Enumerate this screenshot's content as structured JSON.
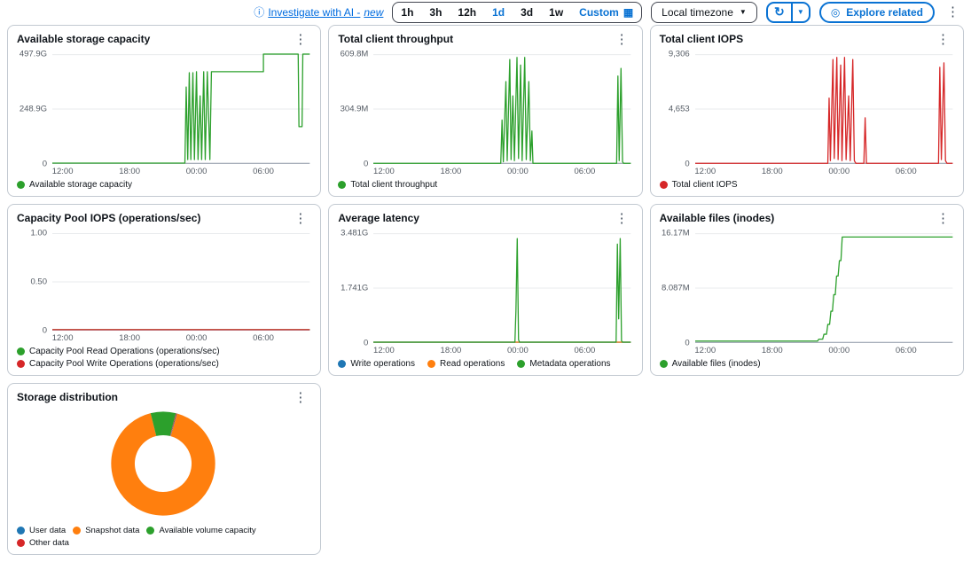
{
  "icons": {
    "info": "ⓘ",
    "calendar": "▦",
    "caret_down": "▼",
    "refresh": "↻",
    "explore": "◎",
    "kebab": "⋮"
  },
  "palette": {
    "blue": "#1f77b4",
    "orange": "#ff7f0e",
    "green": "#2ca02c",
    "red": "#d62728",
    "link": "#006ce0",
    "button_blue": "#0972d3"
  },
  "toolbar": {
    "investigate_label": "Investigate with AI -",
    "investigate_new": "new",
    "time_ranges": [
      "1h",
      "3h",
      "12h",
      "1d",
      "3d",
      "1w",
      "Custom"
    ],
    "selected_range": "1d",
    "timezone_label": "Local timezone",
    "explore_label": "Explore related"
  },
  "charts": [
    {
      "type": "line",
      "title": "Available storage capacity",
      "y_ticks": [
        "497.9G",
        "248.9G",
        "0"
      ],
      "x_ticks": [
        {
          "label": "12:00",
          "x": 4
        },
        {
          "label": "18:00",
          "x": 30
        },
        {
          "label": "00:00",
          "x": 56
        },
        {
          "label": "06:00",
          "x": 82
        }
      ],
      "legend": [
        {
          "label": "Available storage capacity",
          "color": "#2ca02c"
        }
      ],
      "series": [
        {
          "name": "Available storage capacity",
          "color": "#2ca02c",
          "points": [
            [
              0,
              0.8
            ],
            [
              51.5,
              0.8
            ],
            [
              52,
              70
            ],
            [
              52.6,
              4
            ],
            [
              53.2,
              83
            ],
            [
              53.8,
              4
            ],
            [
              54.6,
              83
            ],
            [
              55.2,
              4
            ],
            [
              56,
              84
            ],
            [
              56.6,
              4
            ],
            [
              57.4,
              62
            ],
            [
              58,
              4
            ],
            [
              58.8,
              84
            ],
            [
              59.4,
              4
            ],
            [
              60.2,
              84
            ],
            [
              61.2,
              4
            ],
            [
              61.8,
              84
            ],
            [
              82,
              84
            ],
            [
              82,
              100
            ],
            [
              95.5,
              100
            ],
            [
              95.8,
              34
            ],
            [
              97,
              34
            ],
            [
              97.3,
              100
            ],
            [
              100,
              100
            ]
          ]
        }
      ]
    },
    {
      "type": "line",
      "title": "Total client throughput",
      "y_ticks": [
        "609.8M",
        "304.9M",
        "0"
      ],
      "x_ticks": [
        {
          "label": "12:00",
          "x": 4
        },
        {
          "label": "18:00",
          "x": 30
        },
        {
          "label": "00:00",
          "x": 56
        },
        {
          "label": "06:00",
          "x": 82
        }
      ],
      "legend": [
        {
          "label": "Total client throughput",
          "color": "#2ca02c"
        }
      ],
      "series": [
        {
          "name": "Total client throughput",
          "color": "#2ca02c",
          "points": [
            [
              0,
              0.6
            ],
            [
              49.5,
              0.6
            ],
            [
              50,
              40
            ],
            [
              50.5,
              2
            ],
            [
              51.5,
              75
            ],
            [
              52,
              3
            ],
            [
              53,
              95
            ],
            [
              53.5,
              4
            ],
            [
              54.2,
              62
            ],
            [
              54.8,
              3
            ],
            [
              55.8,
              97
            ],
            [
              56.4,
              5
            ],
            [
              57.2,
              90
            ],
            [
              57.8,
              3
            ],
            [
              58.8,
              97
            ],
            [
              59.4,
              4
            ],
            [
              60.4,
              75
            ],
            [
              61,
              3
            ],
            [
              61.6,
              30
            ],
            [
              62,
              0.6
            ],
            [
              94.5,
              0.6
            ],
            [
              95,
              80
            ],
            [
              95.5,
              3
            ],
            [
              96.2,
              87
            ],
            [
              96.8,
              2
            ],
            [
              97.2,
              0.6
            ],
            [
              100,
              0.6
            ]
          ]
        }
      ]
    },
    {
      "type": "line",
      "title": "Total client IOPS",
      "y_ticks": [
        "9,306",
        "4,653",
        "0"
      ],
      "x_ticks": [
        {
          "label": "12:00",
          "x": 4
        },
        {
          "label": "18:00",
          "x": 30
        },
        {
          "label": "00:00",
          "x": 56
        },
        {
          "label": "06:00",
          "x": 82
        }
      ],
      "legend": [
        {
          "label": "Total client IOPS",
          "color": "#d62728"
        }
      ],
      "series": [
        {
          "name": "Total client IOPS",
          "color": "#d62728",
          "points": [
            [
              0,
              0.6
            ],
            [
              51.5,
              0.6
            ],
            [
              52,
              60
            ],
            [
              52.5,
              3
            ],
            [
              53.5,
              95
            ],
            [
              54,
              5
            ],
            [
              55,
              97
            ],
            [
              55.5,
              4
            ],
            [
              56.5,
              90
            ],
            [
              57,
              3
            ],
            [
              58,
              97
            ],
            [
              58.6,
              4
            ],
            [
              59.6,
              62
            ],
            [
              60.2,
              3
            ],
            [
              61.2,
              95
            ],
            [
              61.8,
              3
            ],
            [
              62.4,
              0.6
            ],
            [
              65.5,
              0.6
            ],
            [
              66,
              42
            ],
            [
              66.5,
              0.6
            ],
            [
              94.5,
              0.6
            ],
            [
              95,
              88
            ],
            [
              95.6,
              4
            ],
            [
              96.6,
              92
            ],
            [
              97.2,
              3
            ],
            [
              97.8,
              0.6
            ],
            [
              100,
              0.6
            ]
          ]
        }
      ]
    },
    {
      "type": "line",
      "title": "Capacity Pool IOPS (operations/sec)",
      "y_ticks": [
        "1.00",
        "0.50",
        "0"
      ],
      "x_ticks": [
        {
          "label": "12:00",
          "x": 4
        },
        {
          "label": "18:00",
          "x": 30
        },
        {
          "label": "00:00",
          "x": 56
        },
        {
          "label": "06:00",
          "x": 82
        }
      ],
      "legend": [
        {
          "label": "Capacity Pool Read Operations (operations/sec)",
          "color": "#2ca02c"
        },
        {
          "label": "Capacity Pool Write Operations (operations/sec)",
          "color": "#d62728"
        }
      ],
      "series": [
        {
          "name": "Capacity Pool Read Operations (operations/sec)",
          "color": "#2ca02c",
          "points": [
            [
              0,
              1
            ],
            [
              100,
              1
            ]
          ]
        },
        {
          "name": "Capacity Pool Write Operations (operations/sec)",
          "color": "#d62728",
          "points": [
            [
              0,
              1
            ],
            [
              100,
              1
            ]
          ]
        }
      ]
    },
    {
      "type": "line",
      "title": "Average latency",
      "y_ticks": [
        "3.481G",
        "1.741G",
        "0"
      ],
      "x_ticks": [
        {
          "label": "12:00",
          "x": 4
        },
        {
          "label": "18:00",
          "x": 30
        },
        {
          "label": "00:00",
          "x": 56
        },
        {
          "label": "06:00",
          "x": 82
        }
      ],
      "legend": [
        {
          "label": "Write operations",
          "color": "#1f77b4"
        },
        {
          "label": "Read operations",
          "color": "#ff7f0e"
        },
        {
          "label": "Metadata operations",
          "color": "#2ca02c"
        }
      ],
      "series": [
        {
          "name": "Write operations",
          "color": "#1f77b4",
          "points": [
            [
              0,
              0.8
            ],
            [
              100,
              0.8
            ]
          ]
        },
        {
          "name": "Read operations",
          "color": "#ff7f0e",
          "points": [
            [
              0,
              0.8
            ],
            [
              100,
              0.8
            ]
          ]
        },
        {
          "name": "Metadata operations",
          "color": "#2ca02c",
          "points": [
            [
              0,
              0.8
            ],
            [
              55,
              0.8
            ],
            [
              55.4,
              30
            ],
            [
              55.9,
              95
            ],
            [
              56.4,
              3
            ],
            [
              56.8,
              0.8
            ],
            [
              94.3,
              0.8
            ],
            [
              94.8,
              90
            ],
            [
              95.3,
              22
            ],
            [
              95.9,
              95
            ],
            [
              96.4,
              2
            ],
            [
              96.8,
              0.8
            ],
            [
              100,
              0.8
            ]
          ]
        }
      ]
    },
    {
      "type": "line",
      "title": "Available files (inodes)",
      "y_ticks": [
        "16.17M",
        "8.087M",
        "0"
      ],
      "x_ticks": [
        {
          "label": "12:00",
          "x": 4
        },
        {
          "label": "18:00",
          "x": 30
        },
        {
          "label": "00:00",
          "x": 56
        },
        {
          "label": "06:00",
          "x": 82
        }
      ],
      "legend": [
        {
          "label": "Available files (inodes)",
          "color": "#2ca02c"
        }
      ],
      "series": [
        {
          "name": "Available files (inodes)",
          "color": "#2ca02c",
          "points": [
            [
              0,
              1.8
            ],
            [
              47.5,
              1.8
            ],
            [
              48,
              3.5
            ],
            [
              49.5,
              3.5
            ],
            [
              50,
              8
            ],
            [
              51,
              8
            ],
            [
              51.5,
              17
            ],
            [
              52.2,
              17
            ],
            [
              52.7,
              29
            ],
            [
              53.3,
              29
            ],
            [
              53.8,
              44
            ],
            [
              54.4,
              44
            ],
            [
              54.9,
              61
            ],
            [
              55.5,
              61
            ],
            [
              56,
              75
            ],
            [
              56.6,
              75
            ],
            [
              57.1,
              96.5
            ],
            [
              100,
              96.5
            ]
          ]
        }
      ]
    },
    {
      "type": "donut",
      "title": "Storage distribution",
      "start_angle": 14.8,
      "slices": [
        {
          "label": "User data",
          "color": "#1f77b4",
          "pct": 0.2
        },
        {
          "label": "Snapshot data",
          "color": "#ff7f0e",
          "pct": 91.8
        },
        {
          "label": "Available volume capacity",
          "color": "#2ca02c",
          "pct": 7.8
        },
        {
          "label": "Other data",
          "color": "#d62728",
          "pct": 0.2
        }
      ],
      "legend": [
        {
          "label": "User data",
          "color": "#1f77b4"
        },
        {
          "label": "Snapshot data",
          "color": "#ff7f0e"
        },
        {
          "label": "Available volume capacity",
          "color": "#2ca02c"
        },
        {
          "label": "Other data",
          "color": "#d62728"
        }
      ]
    }
  ]
}
